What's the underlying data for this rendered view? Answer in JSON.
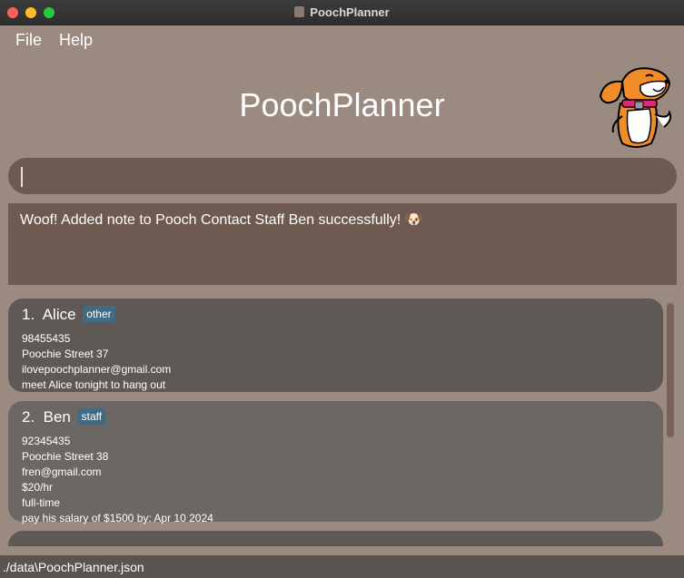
{
  "window": {
    "title": "PoochPlanner"
  },
  "menu": {
    "file": "File",
    "help": "Help"
  },
  "header": {
    "title": "PoochPlanner",
    "mascot_icon": "dog-mascot-icon"
  },
  "command": {
    "value": ""
  },
  "result": {
    "message": "Woof! Added note to Pooch Contact Staff Ben successfully! 🐶"
  },
  "contacts": [
    {
      "index": "1.",
      "name": "Alice",
      "tag": "other",
      "phone": "98455435",
      "address": "Poochie Street 37",
      "email": "ilovepoochplanner@gmail.com",
      "note": "meet Alice tonight to hang out"
    },
    {
      "index": "2.",
      "name": "Ben",
      "tag": "staff",
      "phone": "92345435",
      "address": "Poochie Street 38",
      "email": "fren@gmail.com",
      "salary": "$20/hr",
      "employment": "full-time",
      "note": "pay his salary of $1500 by: Apr 10 2024"
    }
  ],
  "statusbar": {
    "path": "./data\\PoochPlanner.json"
  },
  "colors": {
    "background": "#9a8a80",
    "command_box": "#6e5a50",
    "card": "#5f5955",
    "tag": "#3f6b85"
  }
}
